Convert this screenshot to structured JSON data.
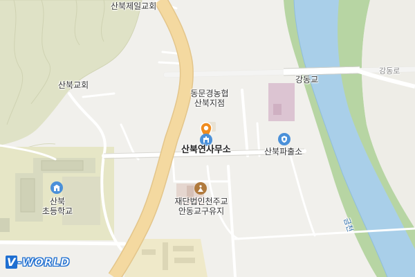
{
  "map": {
    "labels": {
      "church_top": "산북제일교회",
      "church_left": "산북교회",
      "bank_line1": "동문경농협",
      "bank_line2": "산북지점",
      "office": "산북연사무소",
      "police": "산북파출소",
      "bridge": "강동교",
      "road_right": "강동로",
      "heritage_line1": "재단법인천주교",
      "heritage_line2": "안동교구유지",
      "school_line1": "산북",
      "school_line2": "초등학교",
      "river": "금천"
    },
    "logo": {
      "prefix": "V",
      "text": "-WORLD"
    },
    "colors": {
      "background": "#f1f0ec",
      "hills": "#dfe2c6",
      "river": "#a9cfe9",
      "river_bank": "#b7d5a3",
      "main_road": "#f4d9a0",
      "roads": "#ffffff",
      "poi_blue": "#4a90d9",
      "poi_brown": "#b07a3d",
      "marker_orange": "#f08c1f"
    },
    "icons": {
      "bank": "building-icon",
      "office": "government-office-icon",
      "police": "police-icon",
      "heritage": "cultural-site-icon",
      "school": "school-icon",
      "marker": "location-pin-icon"
    }
  }
}
